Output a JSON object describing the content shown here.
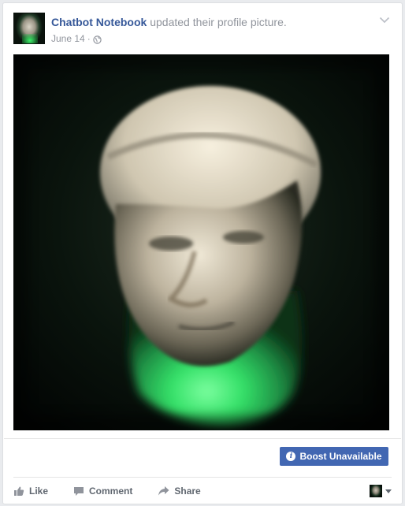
{
  "post": {
    "author": "Chatbot Notebook",
    "action_text": "updated their profile picture.",
    "date": "June 14",
    "separator": "·",
    "privacy_icon": "globe-icon",
    "options_icon": "chevron-down-icon"
  },
  "photo": {
    "description_icon": "sculpture-bust-photo",
    "colors": {
      "background": "#030604",
      "glow": "#3ef06a"
    }
  },
  "boost": {
    "label": "Boost Unavailable",
    "icon": "info-icon",
    "icon_glyph": "i",
    "color": "#4267b2"
  },
  "actions": {
    "like": {
      "label": "Like",
      "icon": "thumbs-up-icon"
    },
    "comment": {
      "label": "Comment",
      "icon": "comment-icon"
    },
    "share": {
      "label": "Share",
      "icon": "share-arrow-icon"
    },
    "audience_icon": "avatar-selector-icon"
  },
  "colors": {
    "link": "#365899",
    "secondary_text": "#90949c",
    "action_text": "#606770"
  }
}
